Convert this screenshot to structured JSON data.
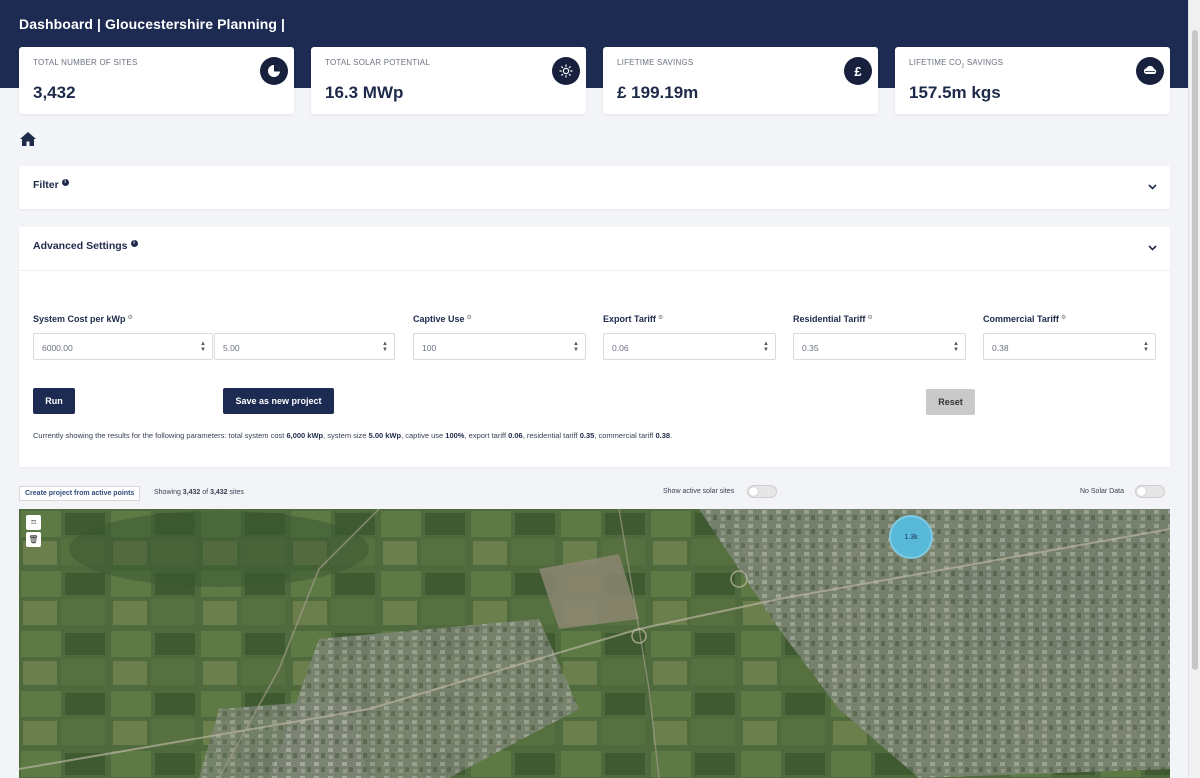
{
  "header": {
    "title": "Dashboard | Gloucestershire Planning |"
  },
  "stats": [
    {
      "label": "TOTAL NUMBER OF SITES",
      "value": "3,432",
      "icon": "pie-chart-icon"
    },
    {
      "label": "TOTAL SOLAR POTENTIAL",
      "value": "16.3 MWp",
      "icon": "sun-icon"
    },
    {
      "label": "LIFETIME SAVINGS",
      "value": "£ 199.19m",
      "icon": "pound-icon"
    },
    {
      "label_prefix": "LIFETIME CO",
      "label_sub": "2",
      "label_suffix": " SAVINGS",
      "value": "157.5m kgs",
      "icon": "cloud-icon"
    }
  ],
  "filter": {
    "title": "Filter"
  },
  "advanced": {
    "title": "Advanced Settings",
    "fields": [
      {
        "label": "System Cost per kWp",
        "values": [
          "6000.00",
          "5.00"
        ]
      },
      {
        "label": "Captive Use",
        "value": "100"
      },
      {
        "label": "Export Tariff",
        "value": "0.06"
      },
      {
        "label": "Residential Tariff",
        "value": "0.35"
      },
      {
        "label": "Commercial Tariff",
        "value": "0.38"
      }
    ],
    "run_label": "Run",
    "save_label": "Save as new project",
    "reset_label": "Reset",
    "summary": {
      "prefix": "Currently showing the results for the following parameters: total system cost ",
      "cost": "6,000 kWp",
      "t1": ", system size ",
      "size": "5.00 kWp",
      "t2": ", captive use ",
      "captive": "100%",
      "t3": ", export tariff ",
      "export": "0.06",
      "t4": ", residential tariff ",
      "residential": "0.35",
      "t5": ", commercial tariff ",
      "commercial": "0.38",
      "t6": "."
    }
  },
  "map_bar": {
    "create_label": "Create project from active points",
    "showing_prefix": "Showing ",
    "showing_count": "3,432",
    "showing_mid": " of ",
    "showing_total": "3,432",
    "showing_suffix": " sites",
    "active_solar_label": "Show active solar sites",
    "no_solar_label": "No Solar Data"
  },
  "map": {
    "cluster_label": "1.3k"
  },
  "colors": {
    "navy": "#1d2b52",
    "cluster": "#59b9d8",
    "reset_grey": "#c9c9c9"
  }
}
